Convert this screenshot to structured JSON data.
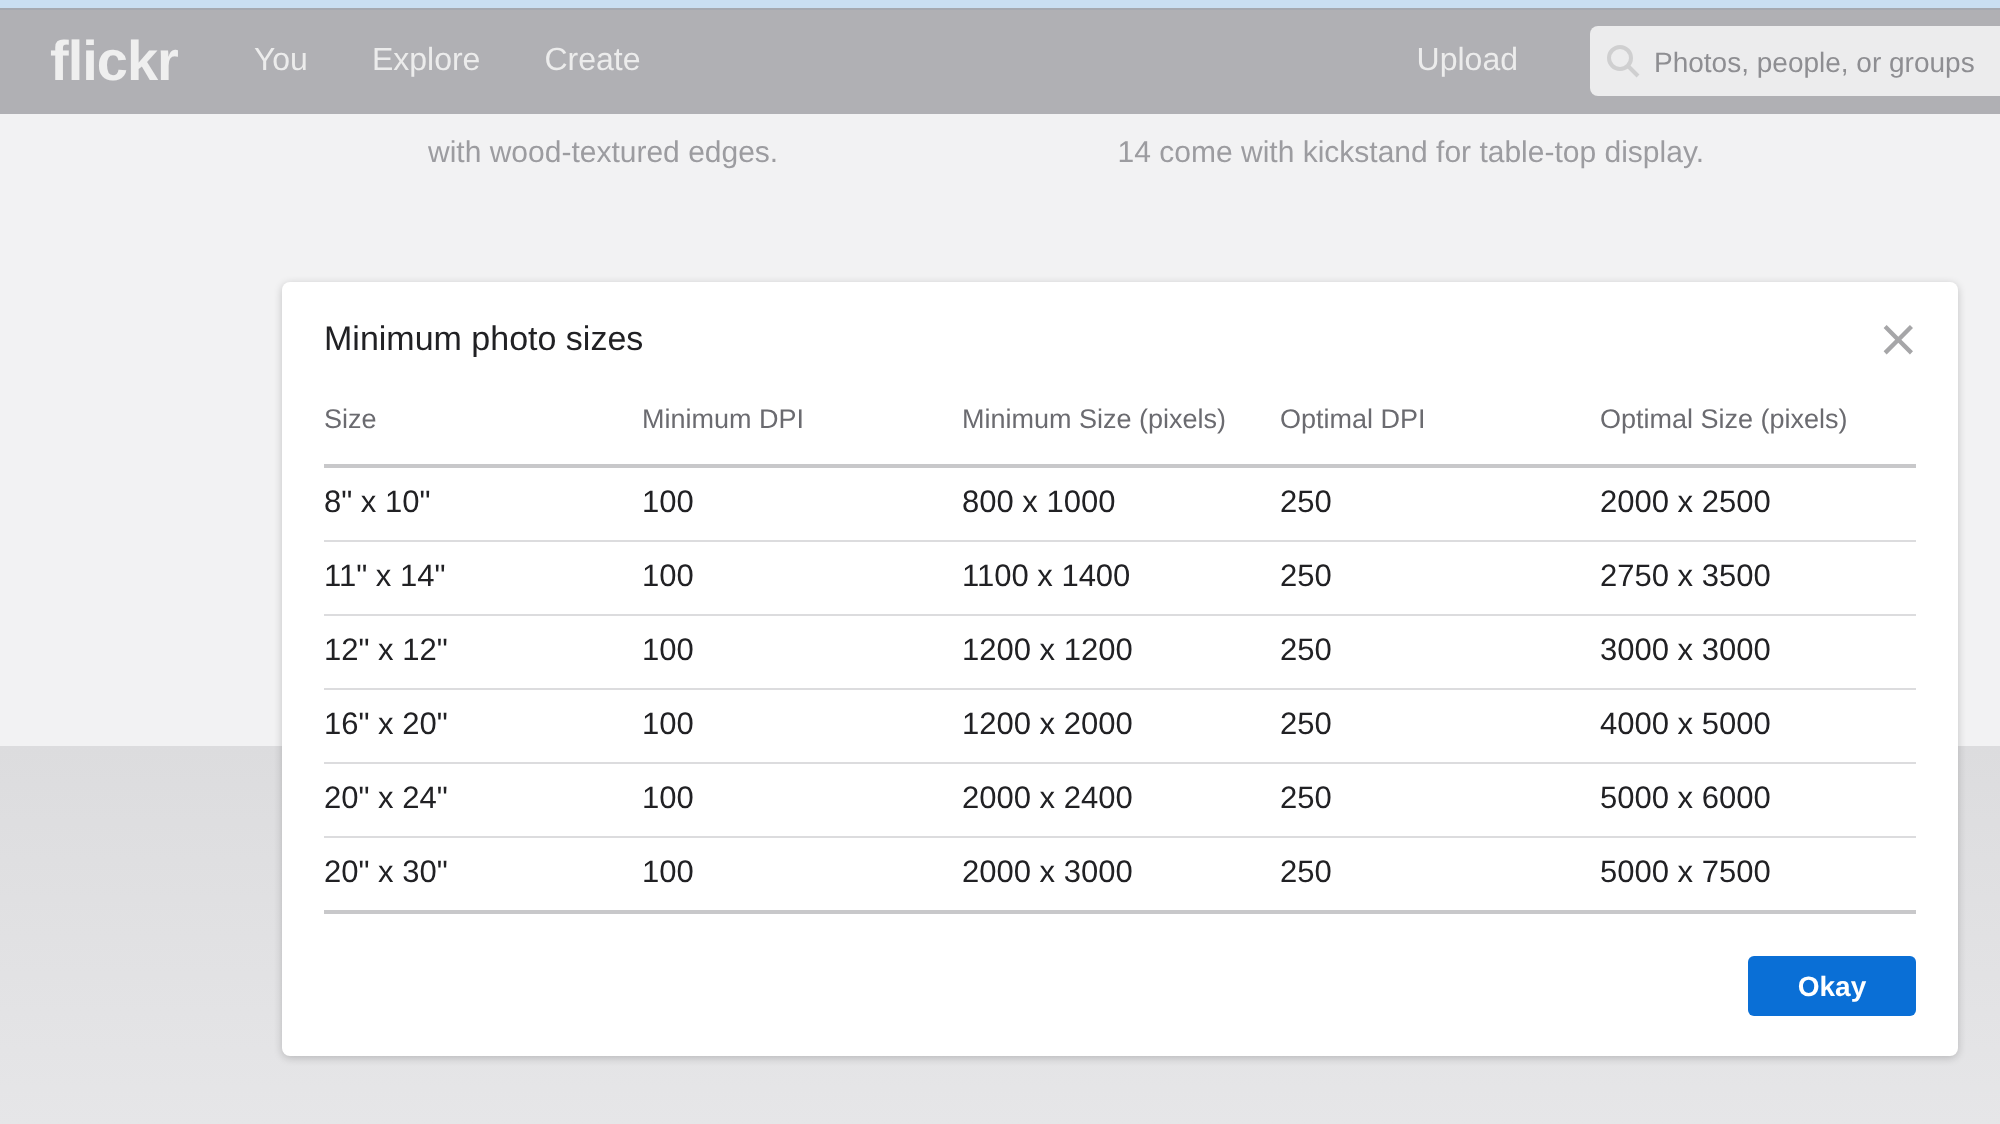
{
  "header": {
    "logo": "flickr",
    "nav": [
      "You",
      "Explore",
      "Create"
    ],
    "upload": "Upload",
    "search": {
      "placeholder": "Photos, people, or groups"
    }
  },
  "background_texts": [
    "with wood-textured edges.",
    "14 come with kickstand for table-top display."
  ],
  "dialog": {
    "title": "Minimum photo sizes",
    "close": "×",
    "table": {
      "columns": [
        "Size",
        "Minimum DPI",
        "Minimum Size (pixels)",
        "Optimal DPI",
        "Optimal Size (pixels)"
      ],
      "rows": [
        [
          "8\" x 10\"",
          "100",
          "800 x 1000",
          "250",
          "2000 x 2500"
        ],
        [
          "11\" x 14\"",
          "100",
          "1100 x 1400",
          "250",
          "2750 x 3500"
        ],
        [
          "12\" x 12\"",
          "100",
          "1200 x 1200",
          "250",
          "3000 x 3000"
        ],
        [
          "16\" x 20\"",
          "100",
          "1200 x 2000",
          "250",
          "4000 x 5000"
        ],
        [
          "20\" x 24\"",
          "100",
          "2000 x 2400",
          "250",
          "5000 x 6000"
        ],
        [
          "20\" x 30\"",
          "100",
          "2000 x 3000",
          "250",
          "5000 x 7500"
        ]
      ]
    },
    "button": "Okay"
  }
}
